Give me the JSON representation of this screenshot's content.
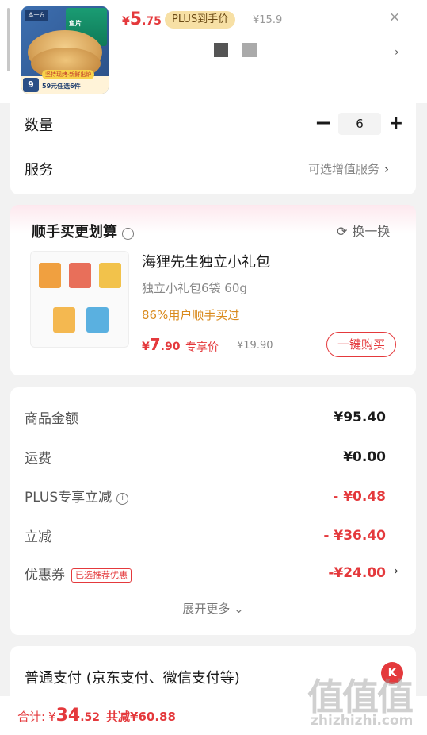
{
  "product": {
    "thumb_brand": "本一方",
    "thumb_bag_text": "鱼片",
    "thumb_badge_num": "9",
    "thumb_tag": "坚持现烤·新鲜出炉",
    "thumb_deal": "59元任选6件",
    "price_symbol": "¥",
    "price_int": "5",
    "price_dec": ".75",
    "plus_pill": "PLUS到手价",
    "original_price": "¥15.9",
    "close_icon": "×",
    "chevron": "›"
  },
  "quantity": {
    "label": "数量",
    "minus": "−",
    "value": "6",
    "plus": "+"
  },
  "service": {
    "label": "服务",
    "value": "可选增值服务",
    "chevron": "›"
  },
  "bundle": {
    "title": "顺手买更划算",
    "info": "i",
    "refresh_icon": "⟳",
    "refresh_label": "换一换",
    "name": "海狸先生独立小礼包",
    "spec": "独立小礼包6袋 60g",
    "buyers": "86%用户顺手买过",
    "price_symbol": "¥",
    "price_int": "7",
    "price_dec": ".90",
    "exclusive": "专享价",
    "original_price": "¥19.90",
    "buy_button": "一键购买"
  },
  "fees": {
    "goods_label": "商品金额",
    "goods_value": "¥95.40",
    "shipping_label": "运费",
    "shipping_value": "¥0.00",
    "plus_label": "PLUS专享立减",
    "plus_value": "- ¥0.48",
    "instant_label": "立减",
    "instant_value": "- ¥36.40",
    "coupon_label": "优惠券",
    "coupon_tag": "已选推荐优惠",
    "coupon_value": "-¥24.00",
    "coupon_chevron": "›",
    "expand": "展开更多 ⌄"
  },
  "payment": {
    "label": "普通支付 (京东支付、微信支付等)",
    "logo": "K"
  },
  "footer": {
    "total_label": "合计:",
    "symbol": "¥",
    "total_int": "34",
    "total_dec": ".52",
    "save": "共减¥60.88"
  },
  "watermark": {
    "big": "值值值",
    "small": "zhizhizhi.com"
  },
  "colors": {
    "accent": "#e4393c",
    "plus_gold": "#f7e0a5",
    "buyers_orange": "#d98a1d"
  }
}
